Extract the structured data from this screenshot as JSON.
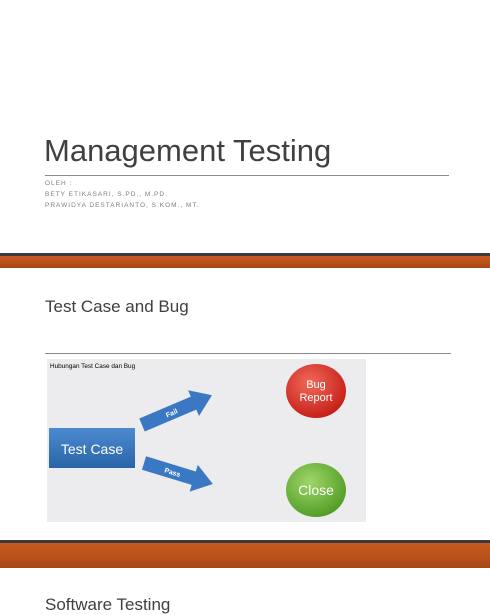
{
  "slide1": {
    "title": "Management Testing",
    "subtitle_lines": [
      "OLEH :",
      "BETY ETIKASARI, S.PD., M.PD.",
      "PRAWIDYA DESTARIANTO, S.KOM., MT."
    ]
  },
  "slide2": {
    "title": "Test Case and Bug",
    "caption": "Hubungan Test Case dan Bug",
    "diagram": {
      "source": "Test Case",
      "fail_label": "Fail",
      "pass_label": "Pass",
      "bug_line1": "Bug",
      "bug_line2": "Report",
      "close_label": "Close",
      "colors": {
        "source": "#2f6fb5",
        "arrow": "#3a78c3",
        "bug": "#d4231b",
        "close": "#5ba82c"
      }
    }
  },
  "slide3": {
    "title": "Software Testing"
  }
}
